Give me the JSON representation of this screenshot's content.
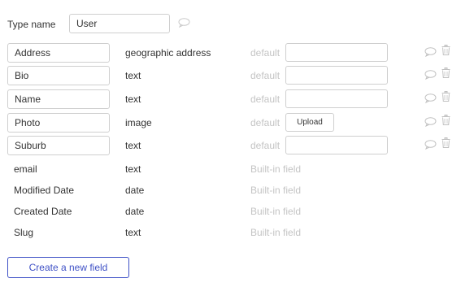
{
  "type_name": {
    "label": "Type name",
    "value": "User",
    "comment_icon": "comment-icon"
  },
  "custom_fields": [
    {
      "name": "Address",
      "type": "geographic address",
      "default_label": "default",
      "default_control": "input",
      "default_value": ""
    },
    {
      "name": "Bio",
      "type": "text",
      "default_label": "default",
      "default_control": "input",
      "default_value": ""
    },
    {
      "name": "Name",
      "type": "text",
      "default_label": "default",
      "default_control": "input",
      "default_value": ""
    },
    {
      "name": "Photo",
      "type": "image",
      "default_label": "default",
      "default_control": "upload",
      "upload_label": "Upload"
    },
    {
      "name": "Suburb",
      "type": "text",
      "default_label": "default",
      "default_control": "input",
      "default_value": ""
    }
  ],
  "builtin_fields": [
    {
      "name": "email",
      "type": "text",
      "note": "Built-in field"
    },
    {
      "name": "Modified Date",
      "type": "date",
      "note": "Built-in field"
    },
    {
      "name": "Created Date",
      "type": "date",
      "note": "Built-in field"
    },
    {
      "name": "Slug",
      "type": "text",
      "note": "Built-in field"
    }
  ],
  "create_button_label": "Create a new field",
  "icons": {
    "comment": "comment-icon",
    "delete": "trash-icon"
  },
  "colors": {
    "accent": "#3f51c6",
    "muted_text": "#c4c4c4",
    "border": "#cfcfcf"
  }
}
